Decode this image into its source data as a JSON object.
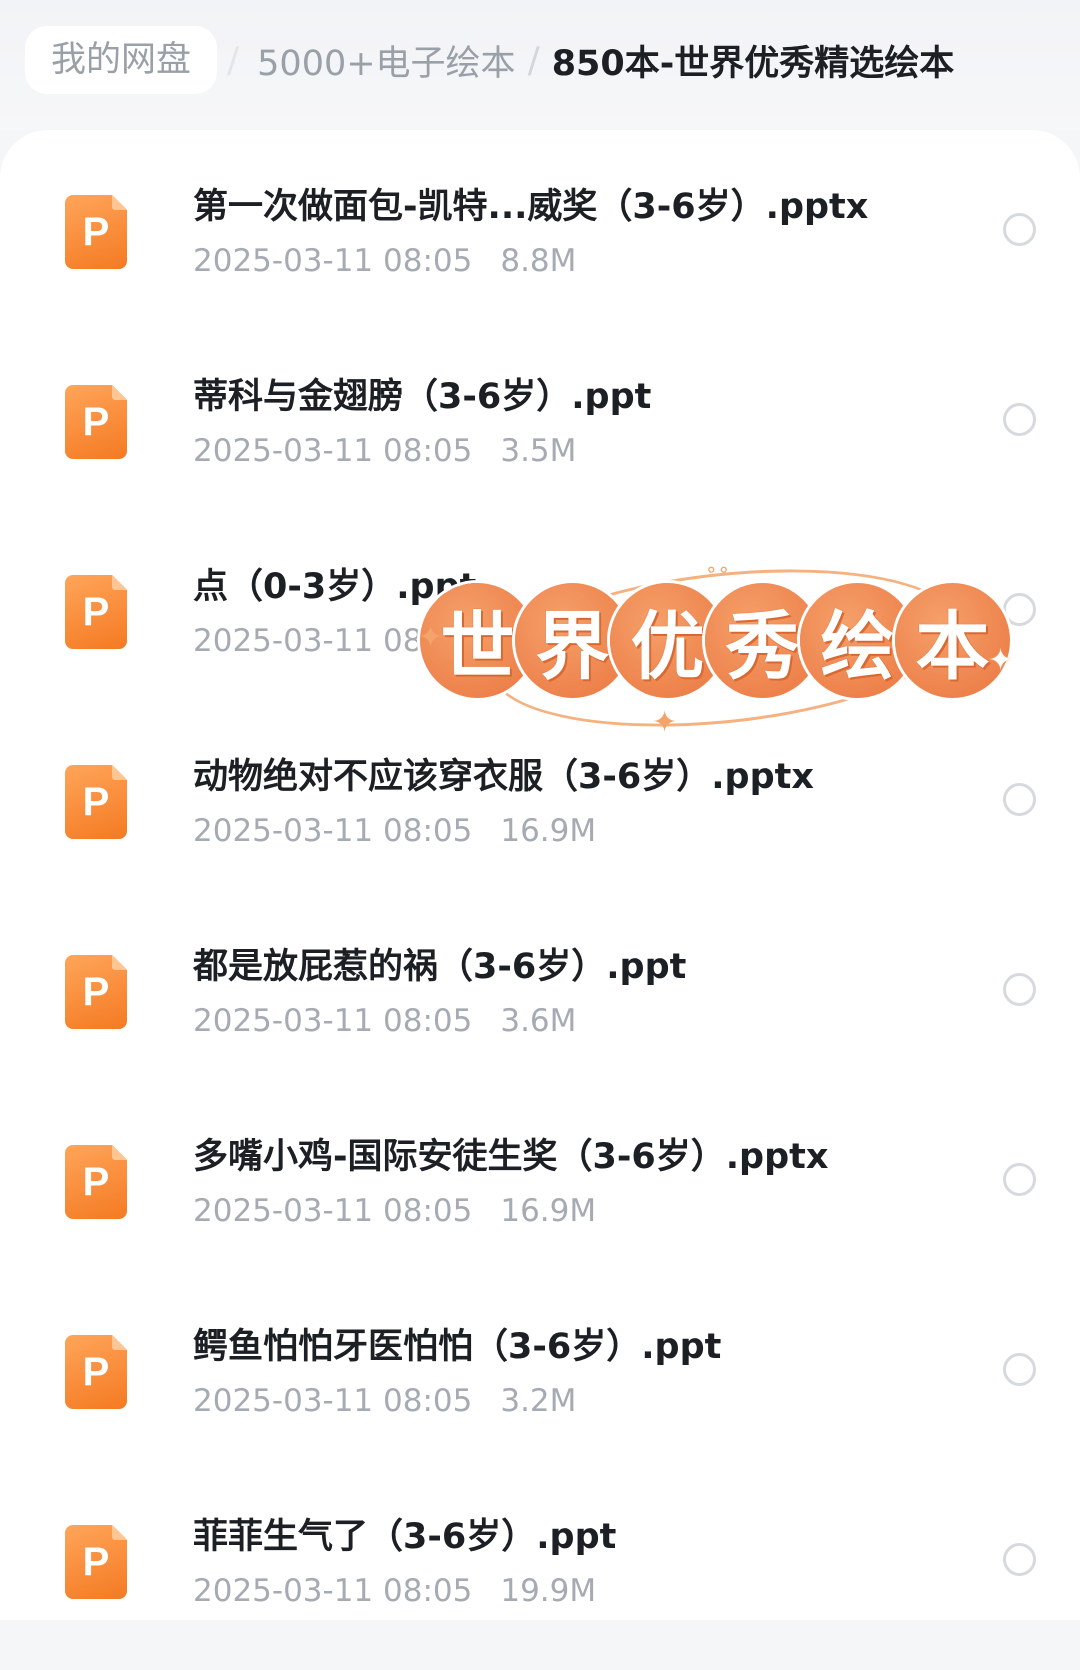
{
  "breadcrumb": {
    "home": "我的网盘",
    "middle": "5000+电子绘本",
    "current": "850本-世界优秀精选绘本",
    "separator": "/"
  },
  "files": [
    {
      "name": "第一次做面包-凯特...威奖（3-6岁）.pptx",
      "date": "2025-03-11 08:05",
      "size": "8.8M",
      "icon": "ppt-file-icon"
    },
    {
      "name": "蒂科与金翅膀（3-6岁）.ppt",
      "date": "2025-03-11 08:05",
      "size": "3.5M",
      "icon": "ppt-file-icon"
    },
    {
      "name": "点（0-3岁）.ppt",
      "date": "2025-03-11 08:05",
      "size": "",
      "icon": "ppt-file-icon"
    },
    {
      "name": "动物绝对不应该穿衣服（3-6岁）.pptx",
      "date": "2025-03-11 08:05",
      "size": "16.9M",
      "icon": "ppt-file-icon"
    },
    {
      "name": "都是放屁惹的祸（3-6岁）.ppt",
      "date": "2025-03-11 08:05",
      "size": "3.6M",
      "icon": "ppt-file-icon"
    },
    {
      "name": "多嘴小鸡-国际安徒生奖（3-6岁）.pptx",
      "date": "2025-03-11 08:05",
      "size": "16.9M",
      "icon": "ppt-file-icon"
    },
    {
      "name": "鳄鱼怕怕牙医怕怕（3-6岁）.ppt",
      "date": "2025-03-11 08:05",
      "size": "3.2M",
      "icon": "ppt-file-icon"
    },
    {
      "name": "菲菲生气了（3-6岁）.ppt",
      "date": "2025-03-11 08:05",
      "size": "19.9M",
      "icon": "ppt-file-icon"
    }
  ],
  "sticker": {
    "chars": [
      "世",
      "界",
      "优",
      "秀",
      "绘",
      "本"
    ]
  },
  "colors": {
    "icon_orange": "#f47a22",
    "sticker_orange": "#eb7640",
    "meta_gray": "#a6abb3",
    "title_dark": "#1c1f24"
  }
}
